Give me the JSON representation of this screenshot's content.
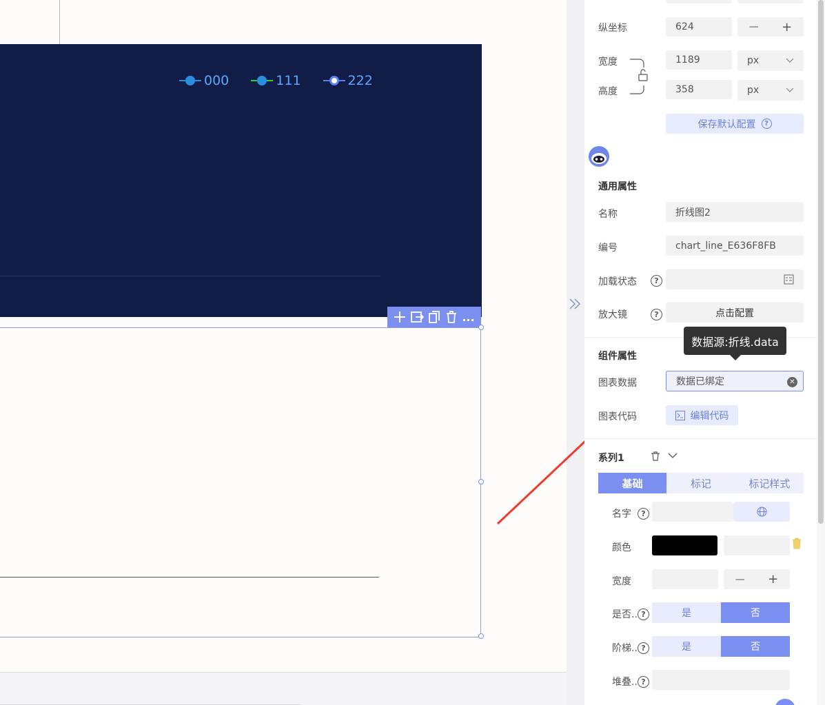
{
  "legend": [
    {
      "label": "000",
      "line_color": "#2a8de0",
      "dot_color": "#2a8de0",
      "hollow": false
    },
    {
      "label": "111",
      "line_color": "#2ecc40",
      "dot_color": "#2a8de0",
      "hollow": false
    },
    {
      "label": "222",
      "line_color": "#5a7ff0",
      "dot_color": "#ffffff",
      "hollow": true
    }
  ],
  "toolbar": {
    "icons": [
      "plus-icon",
      "export-icon",
      "copy-icon",
      "trash-icon",
      "more-icon"
    ],
    "more_label": "..."
  },
  "panel": {
    "y_coord_label": "纵坐标",
    "y_coord_value": "624",
    "stepper_minus": "—",
    "stepper_plus": "+",
    "width_label": "宽度",
    "width_value": "1189",
    "width_unit": "px",
    "height_label": "高度",
    "height_value": "358",
    "height_unit": "px",
    "save_default_label": "保存默认配置",
    "general_section_title": "通用属性",
    "name_label": "名称",
    "name_value": "折线图2",
    "id_label": "编号",
    "id_value": "chart_line_E636F8FB",
    "loading_label": "加载状态",
    "magnifier_label": "放大镜",
    "magnifier_button": "点击配置",
    "component_section_title": "组件属性",
    "chart_data_label": "图表数据",
    "chart_data_value": "数据已绑定",
    "chart_code_label": "图表代码",
    "edit_code_button": "编辑代码",
    "tooltip_text": "数据源:折线.data",
    "series_title": "系列1",
    "tabs": [
      "基础",
      "标记",
      "标记样式"
    ],
    "active_tab": 0,
    "field_name_label": "名字",
    "field_color_label": "颜色",
    "field_color_value": "#000000",
    "field_width_label": "宽度",
    "field_isfoo_label": "是否..",
    "field_step_label": "阶梯..",
    "field_stack_label": "堆叠..",
    "yes_label": "是",
    "no_label": "否",
    "question_mark": "?"
  }
}
